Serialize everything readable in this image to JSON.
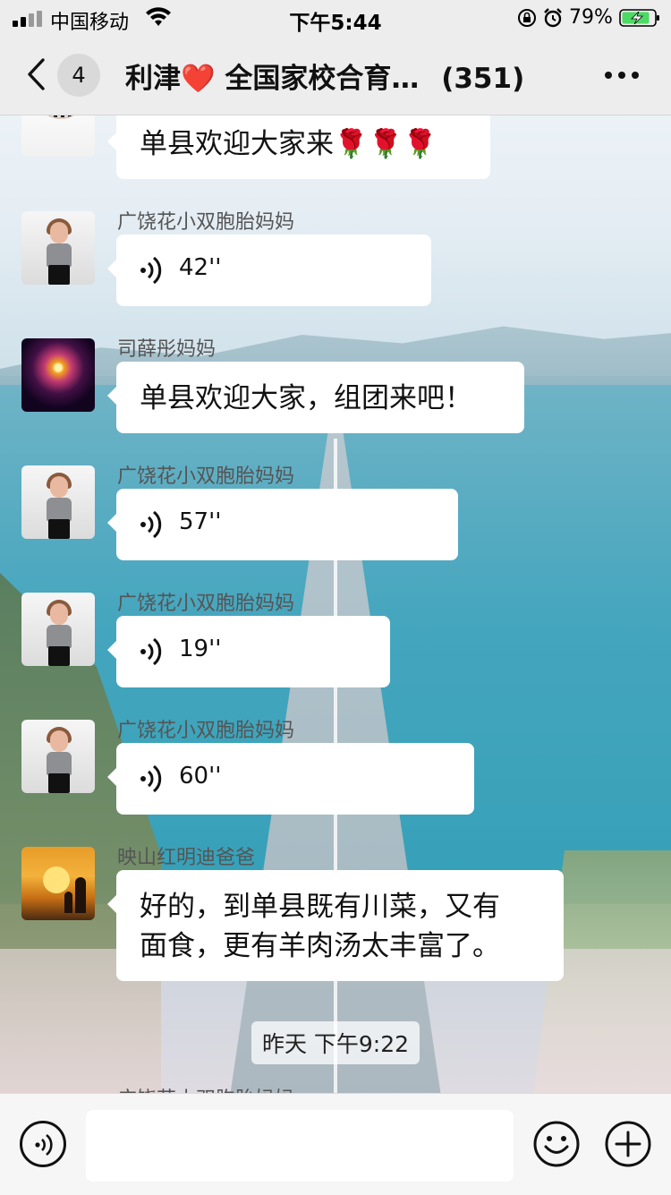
{
  "status_bar": {
    "carrier": "中国移动",
    "time": "下午5:44",
    "battery": "79%",
    "icons": [
      "signal-icon",
      "wifi-icon",
      "orientation-lock-icon",
      "alarm-icon",
      "battery-charging-icon"
    ]
  },
  "header": {
    "unread_count": "4",
    "title": "利津❤️ 全国家校合育…",
    "member_count": "(351)",
    "icons": [
      "back-icon",
      "more-icon"
    ]
  },
  "messages": [
    {
      "sender": "",
      "type": "text",
      "text": "单县欢迎大家来🌹🌹🌹",
      "avatar": "necklace-avatar"
    },
    {
      "sender": "广饶花小双胞胎妈妈",
      "type": "voice",
      "duration": "42''",
      "avatar": "woman-portrait-avatar"
    },
    {
      "sender": "司薛彤妈妈",
      "type": "text",
      "text": "单县欢迎大家，组团来吧！",
      "avatar": "fireworks-avatar"
    },
    {
      "sender": "广饶花小双胞胎妈妈",
      "type": "voice",
      "duration": "57''",
      "avatar": "woman-portrait-avatar"
    },
    {
      "sender": "广饶花小双胞胎妈妈",
      "type": "voice",
      "duration": "19''",
      "avatar": "woman-portrait-avatar"
    },
    {
      "sender": "广饶花小双胞胎妈妈",
      "type": "voice",
      "duration": "60''",
      "avatar": "woman-portrait-avatar"
    },
    {
      "sender": "映山红明迪爸爸",
      "type": "text",
      "text_lines": [
        "好的，到单县既有川菜，又有",
        "面食，更有羊肉汤太丰富了。"
      ],
      "avatar": "sunset-avatar"
    }
  ],
  "timestamp": "昨天 下午9:22",
  "partial_sender": "广饶花小双胞胎妈妈",
  "input_bar": {
    "placeholder": "",
    "icons": [
      "voice-input-icon",
      "emoji-icon",
      "plus-icon"
    ]
  },
  "colors": {
    "header_bg": "#ededed",
    "bubble_bg": "#ffffff",
    "input_bar_bg": "#f6f6f6"
  }
}
